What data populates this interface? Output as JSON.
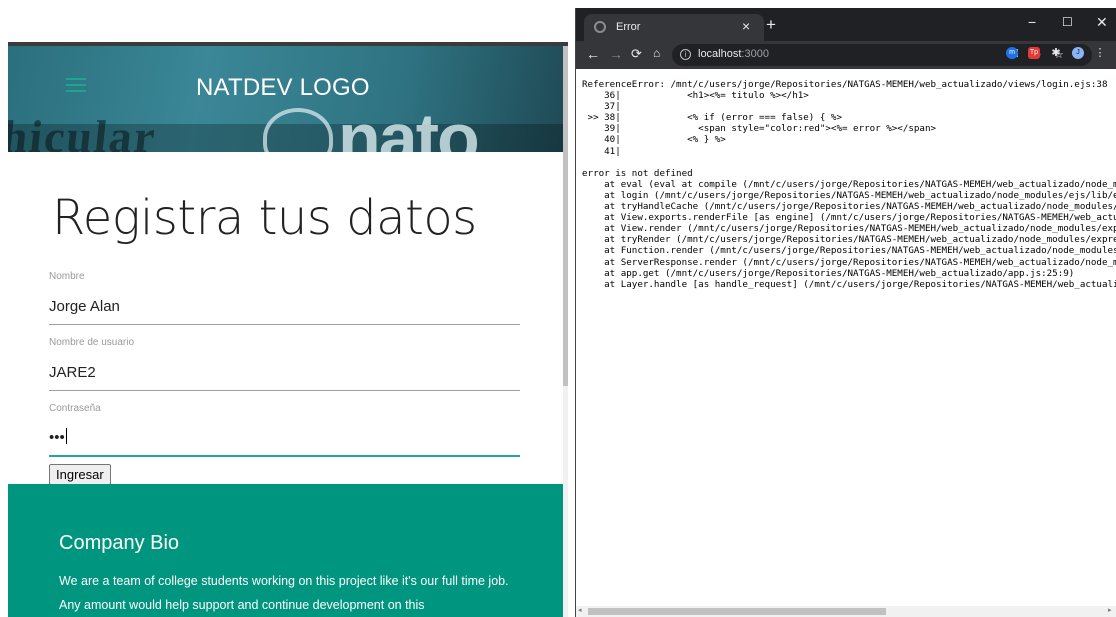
{
  "left": {
    "logo": "NATDEV LOGO",
    "header_bg_text": {
      "word_left": "hicular",
      "brand": "nato"
    },
    "title": "Registra tus datos",
    "fields": {
      "nombre": {
        "label": "Nombre",
        "value": "Jorge Alan"
      },
      "usuario": {
        "label": "Nombre de usuario",
        "value": "JARE2"
      },
      "password": {
        "label": "Contraseña",
        "value": "•••"
      }
    },
    "submit_label": "Ingresar",
    "footer": {
      "title": "Company Bio",
      "text": "We are a team of college students working on this project like it's our full time job. Any amount would help support and continue development on this"
    },
    "colors": {
      "accent": "#00957e",
      "header": "#2f7382"
    }
  },
  "browser": {
    "tab_title": "Error",
    "tab_close": "×",
    "new_tab": "+",
    "window_buttons": {
      "minimize": "−",
      "maximize": "☐",
      "close": "✕"
    },
    "url_host": "localhost",
    "url_port": ":3000",
    "error_lines": [
      "ReferenceError: /mnt/c/users/jorge/Repositories/NATGAS-MEMEH/web_actualizado/views/login.ejs:38",
      "    36|            <h1><%= titulo %></h1>",
      "    37|",
      " >> 38|            <% if (error === false) { %>",
      "    39|              <span style=\"color:red\"><%= error %></span>",
      "    40|            <% } %>",
      "    41|",
      "",
      "error is not defined",
      "    at eval (eval at compile (/mnt/c/users/jorge/Repositories/NATGAS-MEMEH/web_actualizado/node_modules",
      "    at login (/mnt/c/users/jorge/Repositories/NATGAS-MEMEH/web_actualizado/node_modules/ejs/lib/ejs.js",
      "    at tryHandleCache (/mnt/c/users/jorge/Repositories/NATGAS-MEMEH/web_actualizado/node_modules/ejs/lib",
      "    at View.exports.renderFile [as engine] (/mnt/c/users/jorge/Repositories/NATGAS-MEMEH/web_actualizado",
      "    at View.render (/mnt/c/users/jorge/Repositories/NATGAS-MEMEH/web_actualizado/node_modules/express",
      "    at tryRender (/mnt/c/users/jorge/Repositories/NATGAS-MEMEH/web_actualizado/node_modules/express/lib",
      "    at Function.render (/mnt/c/users/jorge/Repositories/NATGAS-MEMEH/web_actualizado/node_modules/express",
      "    at ServerResponse.render (/mnt/c/users/jorge/Repositories/NATGAS-MEMEH/web_actualizado/node_modules",
      "    at app.get (/mnt/c/users/jorge/Repositories/NATGAS-MEMEH/web_actualizado/app.js:25:9)",
      "    at Layer.handle [as handle_request] (/mnt/c/users/jorge/Repositories/NATGAS-MEMEH/web_actualizado"
    ],
    "extensions": [
      {
        "name": "m",
        "color": "#1a73e8"
      },
      {
        "name": "tp",
        "color": "#e53935"
      },
      {
        "name": "puzzle",
        "color": "#e8eaed"
      },
      {
        "name": "J",
        "color": "#8ab4f8"
      }
    ]
  }
}
